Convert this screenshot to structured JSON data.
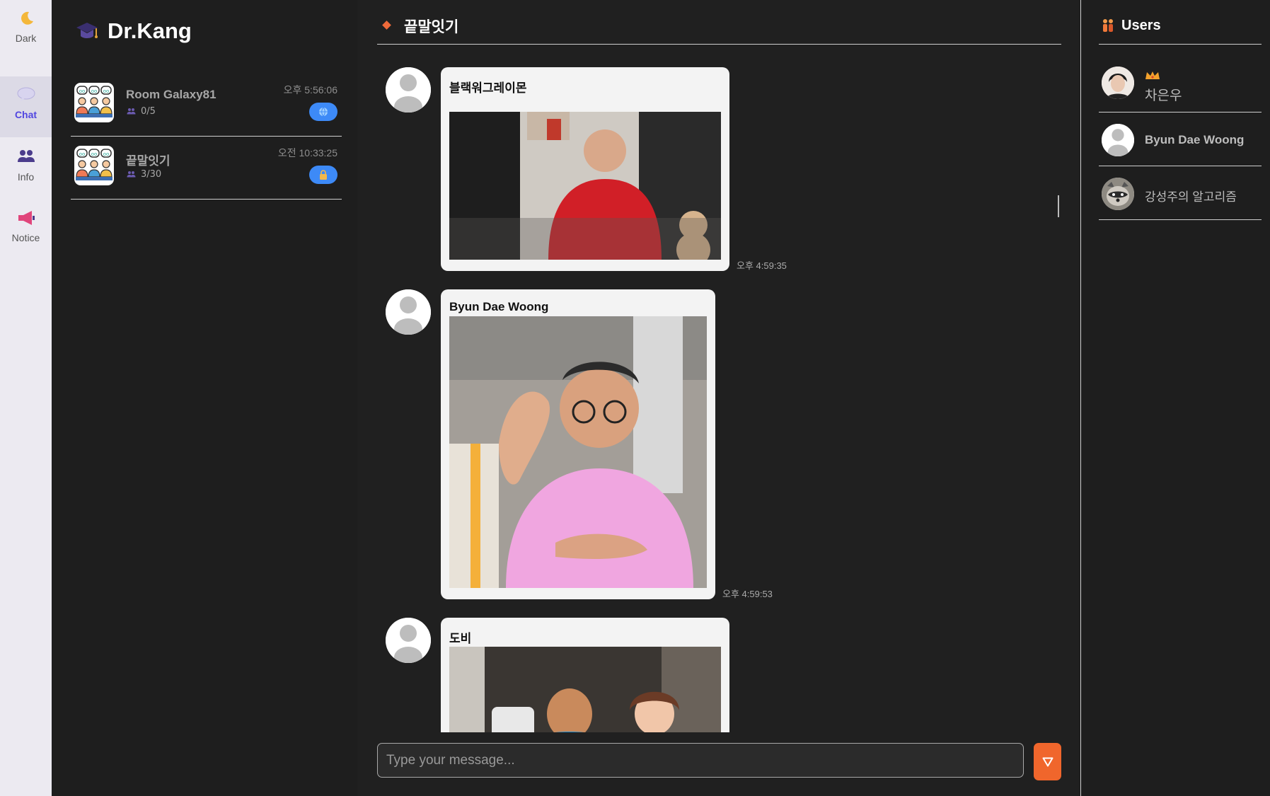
{
  "rail": {
    "items": [
      {
        "label": "Dark",
        "icon": "moon-icon"
      },
      {
        "label": "Chat",
        "icon": "chat-bubble-icon"
      },
      {
        "label": "Info",
        "icon": "people-icon"
      },
      {
        "label": "Notice",
        "icon": "megaphone-icon"
      }
    ],
    "active": "Chat"
  },
  "brand": {
    "name": "Dr.Kang",
    "icon": "graduation-cap-icon"
  },
  "rooms": [
    {
      "title": "Room Galaxy81",
      "count": "0/5",
      "time": "오후 5:56:06",
      "badge_icon": "globe-icon"
    },
    {
      "title": "끝말잇기",
      "count": "3/30",
      "time": "오전 10:33:25",
      "badge_icon": "lock-icon"
    }
  ],
  "chat": {
    "title": "끝말잇기",
    "messages": [
      {
        "sender": "블랙워그레이몬",
        "time": "오후 4:59:35",
        "content": "gif-image"
      },
      {
        "sender": "Byun Dae Woong",
        "time": "오후 4:59:53",
        "content": "gif-image"
      },
      {
        "sender": "도비",
        "content": "gif-image"
      }
    ],
    "input_placeholder": "Type your message..."
  },
  "users": {
    "title": "Users",
    "list": [
      {
        "name": "차은우",
        "is_owner": true,
        "avatar": "photo"
      },
      {
        "name": "Byun Dae Woong",
        "is_owner": false,
        "avatar": "default"
      },
      {
        "name": "강성주의 알고리즘",
        "is_owner": false,
        "avatar": "raccoon"
      }
    ]
  },
  "colors": {
    "accent": "#f0662c",
    "badge": "#3d8af7",
    "active_nav": "#5146e0",
    "bg": "#202020"
  }
}
